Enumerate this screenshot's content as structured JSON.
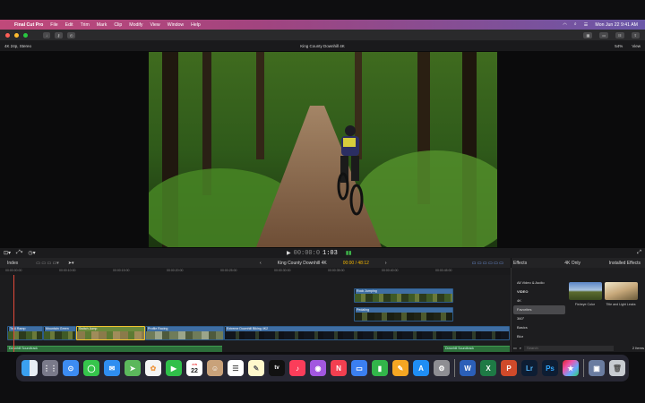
{
  "menubar": {
    "app": "Final Cut Pro",
    "items": [
      "File",
      "Edit",
      "Trim",
      "Mark",
      "Clip",
      "Modify",
      "View",
      "Window",
      "Help"
    ],
    "datetime": "Mon Jun 22  9:41 AM"
  },
  "viewer": {
    "format": "4K 24p, Stereo",
    "title": "King County Downhill 4K",
    "zoom": "54%",
    "view": "View"
  },
  "transport": {
    "timecode_dim": "00:00:0",
    "timecode_bright": "1:03"
  },
  "timeline": {
    "index": "Index",
    "project": "King County Downhill 4K",
    "timecode": "00:00 / 48:12",
    "ruler": [
      "00:00:00:00",
      "00:00:10:00",
      "00:00:15:00",
      "00:00:20:00",
      "00:00:25:00",
      "00:00:30:00",
      "00:00:35:00",
      "00:00:40:00",
      "00:00:45:00"
    ],
    "clips": [
      "Trail Ramp",
      "Mountain Green",
      "Switch Jump",
      "Profile Racing",
      "Extreme Downhill Biking 4K2"
    ],
    "connected": [
      "Rock Jumping",
      "Pedaling"
    ],
    "audio": [
      "Downhill Soundtrack",
      "Downhill Soundtrack"
    ]
  },
  "effects": {
    "title": "Effects",
    "filter": "4K Only",
    "installed": "Installed Effects",
    "categories": [
      "All Video & Audio",
      "VIDEO",
      "4K",
      "Favorites",
      "360°",
      "Basics",
      "Blur"
    ],
    "selected": "Favorites",
    "items": [
      "Fisheye Color",
      "Title and Light Leaks"
    ],
    "search_placeholder": "Search",
    "count": "2 Items"
  },
  "dock": {
    "icons": [
      "finder-icon",
      "launchpad-icon",
      "safari-icon",
      "messages-icon",
      "mail-icon",
      "maps-icon",
      "photos-icon",
      "facetime-icon",
      "calendar-icon",
      "contacts-icon",
      "reminders-icon",
      "notes-icon",
      "tv-icon",
      "music-icon",
      "podcasts-icon",
      "news-icon",
      "keynote-icon",
      "numbers-icon",
      "pages-icon",
      "app-store-icon",
      "settings-icon",
      "word-icon",
      "excel-icon",
      "powerpoint-icon",
      "lightroom-icon",
      "photoshop-icon",
      "final-cut-icon",
      "preview-icon",
      "trash-icon"
    ],
    "calendar_day": "22",
    "calendar_month": "JUN",
    "tv_label": "tv",
    "word_letter": "W",
    "excel_letter": "X",
    "powerpoint_letter": "P",
    "lightroom_letters": "Lr",
    "photoshop_letters": "Ps"
  }
}
